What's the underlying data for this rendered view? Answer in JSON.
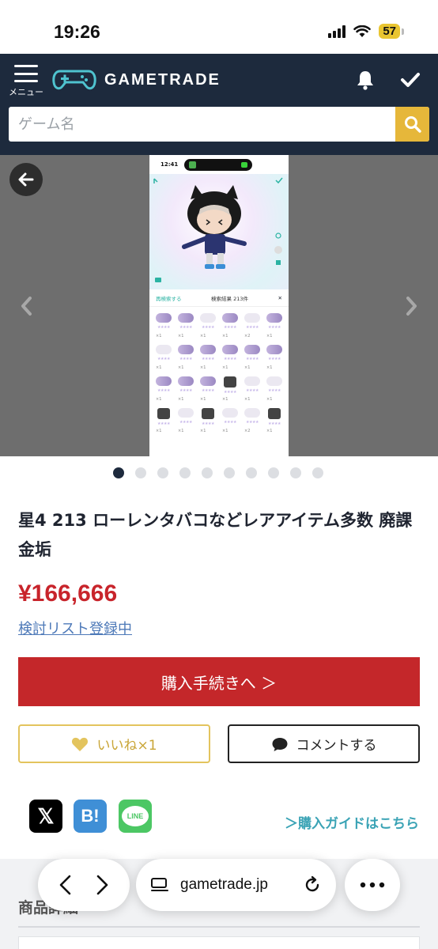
{
  "status_bar": {
    "time": "19:26",
    "battery": "57"
  },
  "header": {
    "menu_label": "メニュー",
    "brand": "GAMETRADE",
    "search_placeholder": "ゲーム名"
  },
  "gallery": {
    "screenshot": {
      "time": "12:41",
      "research_label": "再検索する",
      "result_count": "検索結果 213件"
    },
    "page_count": 10,
    "active_page": 1
  },
  "product": {
    "title": "星4 213 ローレンタバコなどレアアイテム多数 廃課金垢",
    "price": "¥166,666",
    "watchlist_link": "検討リスト登録中",
    "buy_button": "購入手続きへ ＞",
    "like_button": "いいね×1",
    "comment_button": "コメントする",
    "share": {
      "x_label": "𝕏",
      "hatena_label": "B!",
      "line_label": "LINE"
    },
    "guide_link": "＞購入ガイドはこちら"
  },
  "details": {
    "section_title": "商品詳細"
  },
  "browser": {
    "url": "gametrade.jp"
  },
  "colors": {
    "header_bg": "#1d2a3d",
    "search_button": "#e6b73a",
    "buy_button": "#c4272a",
    "price": "#c8242b",
    "like_border": "#e3c45e",
    "guide": "#3aa3b5"
  }
}
